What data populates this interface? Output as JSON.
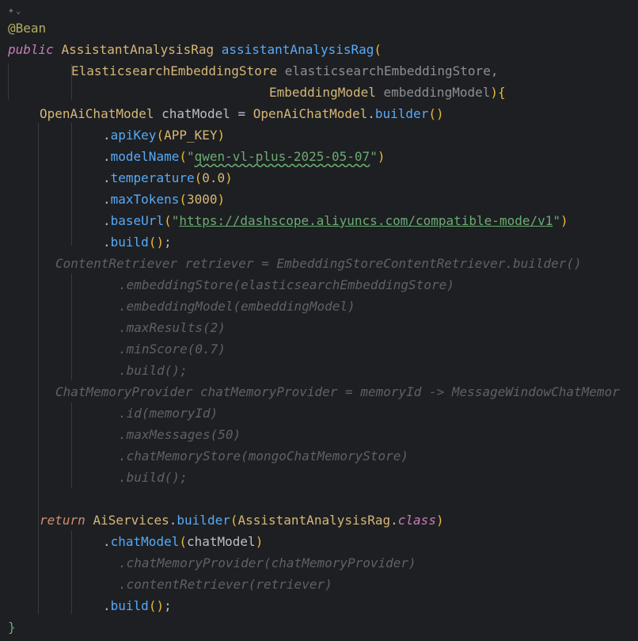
{
  "editor": {
    "gutter_icon": "gutter-icon",
    "colors": {
      "background": "#1e1f22",
      "annotation": "#b3ae60",
      "keyword": "#cf8e6d",
      "method": "#57aaf7",
      "string": "#6aab73",
      "number": "#2aacb8",
      "constant": "#c77dbb",
      "commented_out": "#5f6166"
    },
    "code": {
      "l1_annotation": "@Bean",
      "l2_public": "public",
      "l2_type": "AssistantAnalysisRag",
      "l2_method": "assistantAnalysisRag",
      "l3_type": "ElasticsearchEmbeddingStore",
      "l3_param": "elasticsearchEmbeddingStore,",
      "l4_type": "EmbeddingModel",
      "l4_param": "embeddingModel",
      "l5_type": "OpenAiChatModel",
      "l5_var": "chatModel",
      "l5_eq": " = ",
      "l5_type2": "OpenAiChatModel",
      "l5_call": "builder",
      "l6_call": "apiKey",
      "l6_arg": "APP_KEY",
      "l7_call": "modelName",
      "l7_arg": "qwen-vl-plus-2025-05-07",
      "l8_call": "temperature",
      "l8_arg": "0.0",
      "l9_call": "maxTokens",
      "l9_arg": "3000",
      "l10_call": "baseUrl",
      "l10_arg": "https://dashscope.aliyuncs.com/compatible-mode/v1",
      "l11_call": "build",
      "l12": "ContentRetriever retriever = EmbeddingStoreContentRetriever.builder()",
      "l13": ".embeddingStore(elasticsearchEmbeddingStore)",
      "l14": ".embeddingModel(embeddingModel)",
      "l15": ".maxResults(2)",
      "l16": ".minScore(0.7)",
      "l17": ".build();",
      "l18": "ChatMemoryProvider chatMemoryProvider = memoryId -> MessageWindowChatMemor",
      "l19": ".id(memoryId)",
      "l20": ".maxMessages(50)",
      "l21": ".chatMemoryStore(mongoChatMemoryStore)",
      "l22": ".build();",
      "l24_return": "return",
      "l24_type": "AiServices",
      "l24_call": "builder",
      "l24_arg": "AssistantAnalysisRag",
      "l24_class": "class",
      "l25_call": "chatModel",
      "l25_arg": "chatModel",
      "l26": ".chatMemoryProvider(chatMemoryProvider)",
      "l27": ".contentRetriever(retriever)",
      "l28_call": "build",
      "l29": "}"
    }
  }
}
